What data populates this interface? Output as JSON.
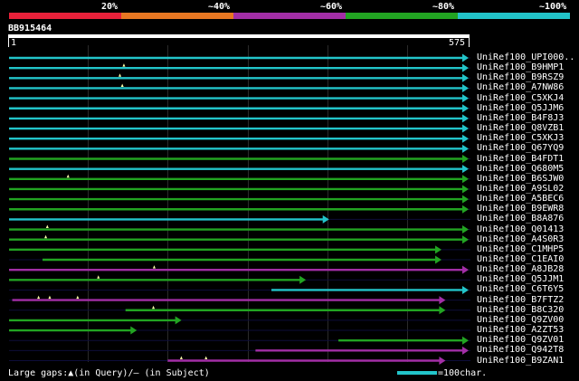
{
  "query": {
    "name": "BB915464",
    "start_label": "1",
    "end_label": "575",
    "length": 575
  },
  "legend": {
    "segments": [
      {
        "label": "20%",
        "color": "#e8213a"
      },
      {
        "label": "~40%",
        "color": "#e87722"
      },
      {
        "label": "~60%",
        "color": "#a22ea6"
      },
      {
        "label": "~80%",
        "color": "#22a422"
      },
      {
        "label": "~100%",
        "color": "#22c4c9"
      }
    ]
  },
  "hits": [
    {
      "name": "UniRef100_UPI000..",
      "start": 1,
      "end": 575,
      "color": "#22c4c9",
      "markers": []
    },
    {
      "name": "UniRef100_B9HMP1",
      "start": 1,
      "end": 575,
      "color": "#22c4c9",
      "markers": [
        145
      ]
    },
    {
      "name": "UniRef100_B9RSZ9",
      "start": 1,
      "end": 575,
      "color": "#22c4c9",
      "markers": [
        140
      ]
    },
    {
      "name": "UniRef100_A7NW86",
      "start": 1,
      "end": 575,
      "color": "#22c4c9",
      "markers": [
        143
      ]
    },
    {
      "name": "UniRef100_C5XKJ4",
      "start": 1,
      "end": 575,
      "color": "#22c4c9",
      "markers": []
    },
    {
      "name": "UniRef100_Q5JJM6",
      "start": 1,
      "end": 575,
      "color": "#22c4c9",
      "markers": []
    },
    {
      "name": "UniRef100_B4F8J3",
      "start": 1,
      "end": 575,
      "color": "#22c4c9",
      "markers": []
    },
    {
      "name": "UniRef100_Q8VZB1",
      "start": 1,
      "end": 575,
      "color": "#22c4c9",
      "markers": []
    },
    {
      "name": "UniRef100_C5XKJ3",
      "start": 1,
      "end": 575,
      "color": "#22c4c9",
      "markers": []
    },
    {
      "name": "UniRef100_Q67YQ9",
      "start": 1,
      "end": 575,
      "color": "#22c4c9",
      "markers": []
    },
    {
      "name": "UniRef100_B4FDT1",
      "start": 1,
      "end": 575,
      "color": "#22a422",
      "markers": []
    },
    {
      "name": "UniRef100_Q680M5",
      "start": 1,
      "end": 575,
      "color": "#22c4c9",
      "markers": []
    },
    {
      "name": "UniRef100_B6SJW0",
      "start": 1,
      "end": 575,
      "color": "#22a422",
      "markers": [
        75
      ]
    },
    {
      "name": "UniRef100_A9SL02",
      "start": 1,
      "end": 575,
      "color": "#22a422",
      "markers": []
    },
    {
      "name": "UniRef100_A5BEC6",
      "start": 1,
      "end": 575,
      "color": "#22a422",
      "markers": []
    },
    {
      "name": "UniRef100_B9EWR8",
      "start": 1,
      "end": 575,
      "color": "#22a422",
      "markers": []
    },
    {
      "name": "UniRef100_B8A876",
      "start": 1,
      "end": 400,
      "color": "#22c4c9",
      "markers": []
    },
    {
      "name": "UniRef100_Q01413",
      "start": 1,
      "end": 575,
      "color": "#22a422",
      "markers": [
        49
      ]
    },
    {
      "name": "UniRef100_A4S0R3",
      "start": 1,
      "end": 575,
      "color": "#22a422",
      "markers": [
        47
      ]
    },
    {
      "name": "UniRef100_C1MHP5",
      "start": 1,
      "end": 541,
      "color": "#22a422",
      "markers": []
    },
    {
      "name": "UniRef100_C1EAI0",
      "start": 43,
      "end": 541,
      "color": "#22a422",
      "markers": []
    },
    {
      "name": "UniRef100_A8JB28",
      "start": 1,
      "end": 575,
      "color": "#a22ea6",
      "markers": [
        183
      ]
    },
    {
      "name": "UniRef100_Q5JJM1",
      "start": 1,
      "end": 371,
      "color": "#22a422",
      "markers": [
        113
      ]
    },
    {
      "name": "UniRef100_C6T6Y5",
      "start": 330,
      "end": 575,
      "color": "#22c4c9",
      "markers": []
    },
    {
      "name": "UniRef100_B7FTZ2",
      "start": 5,
      "end": 546,
      "color": "#a22ea6",
      "markers": [
        38,
        52,
        87
      ]
    },
    {
      "name": "UniRef100_B8C320",
      "start": 147,
      "end": 546,
      "color": "#22a422",
      "markers": [
        182
      ]
    },
    {
      "name": "UniRef100_Q9ZV00",
      "start": 1,
      "end": 215,
      "color": "#22a422",
      "markers": []
    },
    {
      "name": "UniRef100_A2ZT53",
      "start": 1,
      "end": 159,
      "color": "#22a422",
      "markers": []
    },
    {
      "name": "UniRef100_Q9ZV01",
      "start": 414,
      "end": 575,
      "color": "#22a422",
      "markers": []
    },
    {
      "name": "UniRef100_Q942T8",
      "start": 310,
      "end": 575,
      "color": "#a22ea6",
      "markers": []
    },
    {
      "name": "UniRef100_B9ZAN1",
      "start": 200,
      "end": 546,
      "color": "#a22ea6",
      "markers": [
        217,
        248
      ]
    }
  ],
  "footer": {
    "gaps_text": "Large gaps:▲(in Query)/— (in Subject)",
    "scale_text": "=100char."
  }
}
